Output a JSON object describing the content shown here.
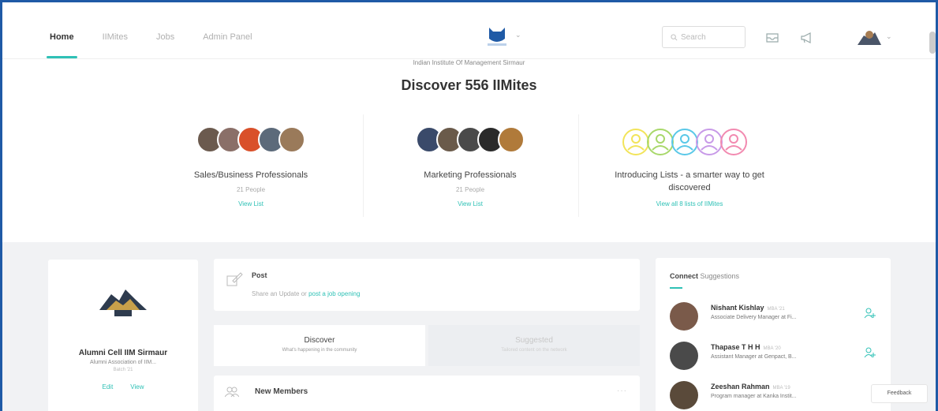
{
  "nav": {
    "links": [
      "Home",
      "IIMites",
      "Jobs",
      "Admin Panel"
    ],
    "search_placeholder": "Search"
  },
  "discover": {
    "subtitle": "Indian Institute Of Management Sirmaur",
    "title": "Discover 556 IIMites",
    "cards": [
      {
        "title": "Sales/Business Professionals",
        "count": "21 People",
        "link": "View List"
      },
      {
        "title": "Marketing Professionals",
        "count": "21 People",
        "link": "View List"
      },
      {
        "title": "Introducing Lists - a smarter way to get discovered",
        "count": "",
        "link": "View all 8 lists of IIMites"
      }
    ]
  },
  "profile": {
    "name": "Alumni Cell IIM Sirmaur",
    "subtitle": "Alumni Association of IIM...",
    "meta": "Batch '21",
    "edit_label": "Edit",
    "view_label": "View"
  },
  "post": {
    "title": "Post",
    "prompt": "Share an Update or",
    "link": "post a job opening"
  },
  "feed_tabs": [
    {
      "label": "Discover",
      "sub": "What's happening in the community"
    },
    {
      "label": "Suggested",
      "sub": "Tailored content on the network"
    }
  ],
  "members": {
    "title": "New Members",
    "more": "···"
  },
  "connect": {
    "title_bold": "Connect",
    "title_rest": "Suggestions",
    "people": [
      {
        "name": "Nishant Kishlay",
        "batch": "MBA '21",
        "role": "Associate Delivery Manager at Fi..."
      },
      {
        "name": "Thapase T H H",
        "batch": "MBA '20",
        "role": "Assistant Manager at Genpact, B..."
      },
      {
        "name": "Zeeshan Rahman",
        "batch": "MBA '19",
        "role": "Program manager at Kanka Instit..."
      }
    ]
  },
  "feedback_label": "Feedback",
  "colors": {
    "accent": "#2fc1b6",
    "frame": "#1f5aa6",
    "background": "#f1f2f4"
  }
}
